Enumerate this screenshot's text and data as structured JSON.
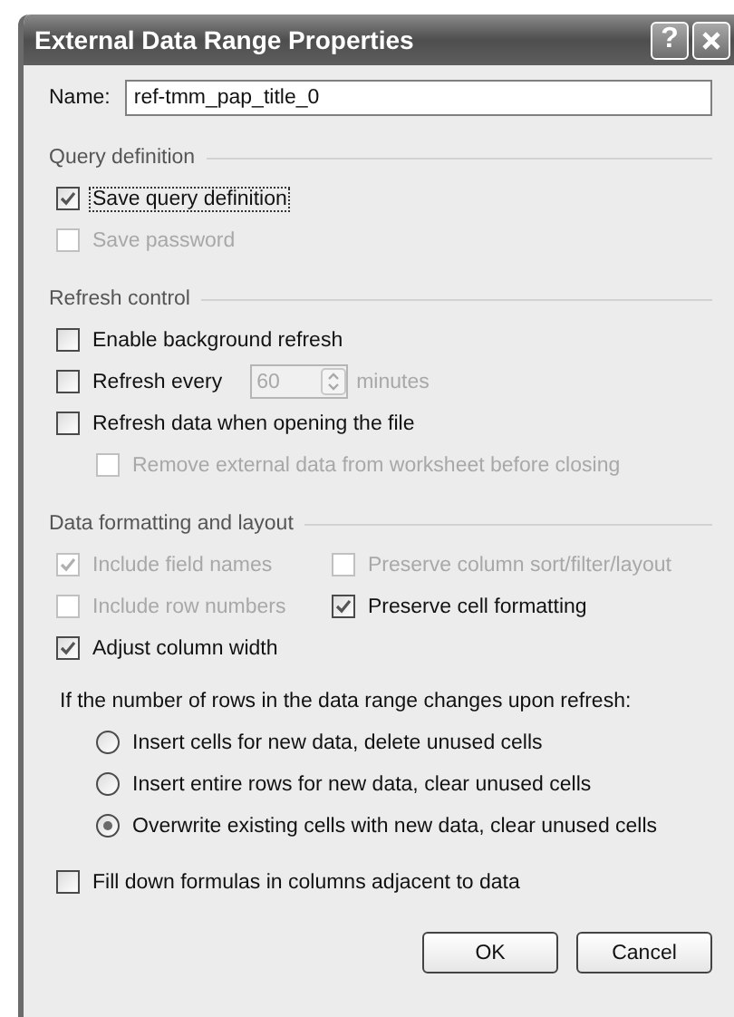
{
  "window": {
    "title": "External Data Range Properties",
    "help": "?"
  },
  "name_field": {
    "label": "Name:",
    "value": "ref-tmm_pap_title_0"
  },
  "sections": [
    {
      "title": "Query definition",
      "rows": [
        [
          {
            "kind": "checkbox",
            "label": "Save query definition",
            "checked": true,
            "disabled": false,
            "focused": true
          }
        ],
        [
          {
            "kind": "checkbox",
            "label": "Save password",
            "checked": false,
            "disabled": true,
            "focused": false
          }
        ]
      ]
    },
    {
      "title": "Refresh control",
      "rows": [
        [
          {
            "kind": "checkbox",
            "label": "Enable background refresh",
            "checked": false,
            "disabled": false,
            "focused": false
          }
        ],
        [
          {
            "kind": "interval",
            "label": "Refresh every",
            "checked": false,
            "disabled": false,
            "focused": false,
            "value": "60",
            "unit": "minutes",
            "field_disabled": true
          }
        ],
        [
          {
            "kind": "checkbox",
            "label": "Refresh data when opening the file",
            "checked": false,
            "disabled": false,
            "focused": false,
            "children": [
              {
                "kind": "checkbox",
                "label": "Remove external data from worksheet before closing",
                "checked": false,
                "disabled": true,
                "focused": false
              }
            ]
          }
        ]
      ]
    },
    {
      "title": "Data formatting and layout",
      "rows": [
        [
          {
            "kind": "checkbox",
            "label": "Include field names",
            "checked": true,
            "disabled": true,
            "focused": false
          },
          {
            "kind": "checkbox",
            "label": "Preserve column sort/filter/layout",
            "checked": false,
            "disabled": true,
            "focused": false
          }
        ],
        [
          {
            "kind": "checkbox",
            "label": "Include row numbers",
            "checked": false,
            "disabled": true,
            "focused": false
          },
          {
            "kind": "checkbox",
            "label": "Preserve cell formatting",
            "checked": true,
            "disabled": false,
            "focused": false
          }
        ],
        [
          {
            "kind": "checkbox",
            "label": "Adjust column width",
            "checked": true,
            "disabled": false,
            "focused": false
          }
        ],
        [
          {
            "kind": "prompt",
            "label": "If the number of rows in the data range changes upon refresh:",
            "children": [
              {
                "kind": "radio",
                "label": "Insert cells for new data, delete unused cells",
                "selected": false,
                "disabled": false
              },
              {
                "kind": "radio",
                "label": "Insert entire rows for new data, clear unused cells",
                "selected": false,
                "disabled": false
              },
              {
                "kind": "radio",
                "label": "Overwrite existing cells with new data, clear unused cells",
                "selected": true,
                "disabled": false
              }
            ]
          }
        ],
        [
          {
            "kind": "checkbox",
            "label": "Fill down formulas in columns adjacent to data",
            "checked": false,
            "disabled": false,
            "focused": false
          }
        ]
      ]
    }
  ],
  "buttons": [
    "OK",
    "Cancel"
  ]
}
